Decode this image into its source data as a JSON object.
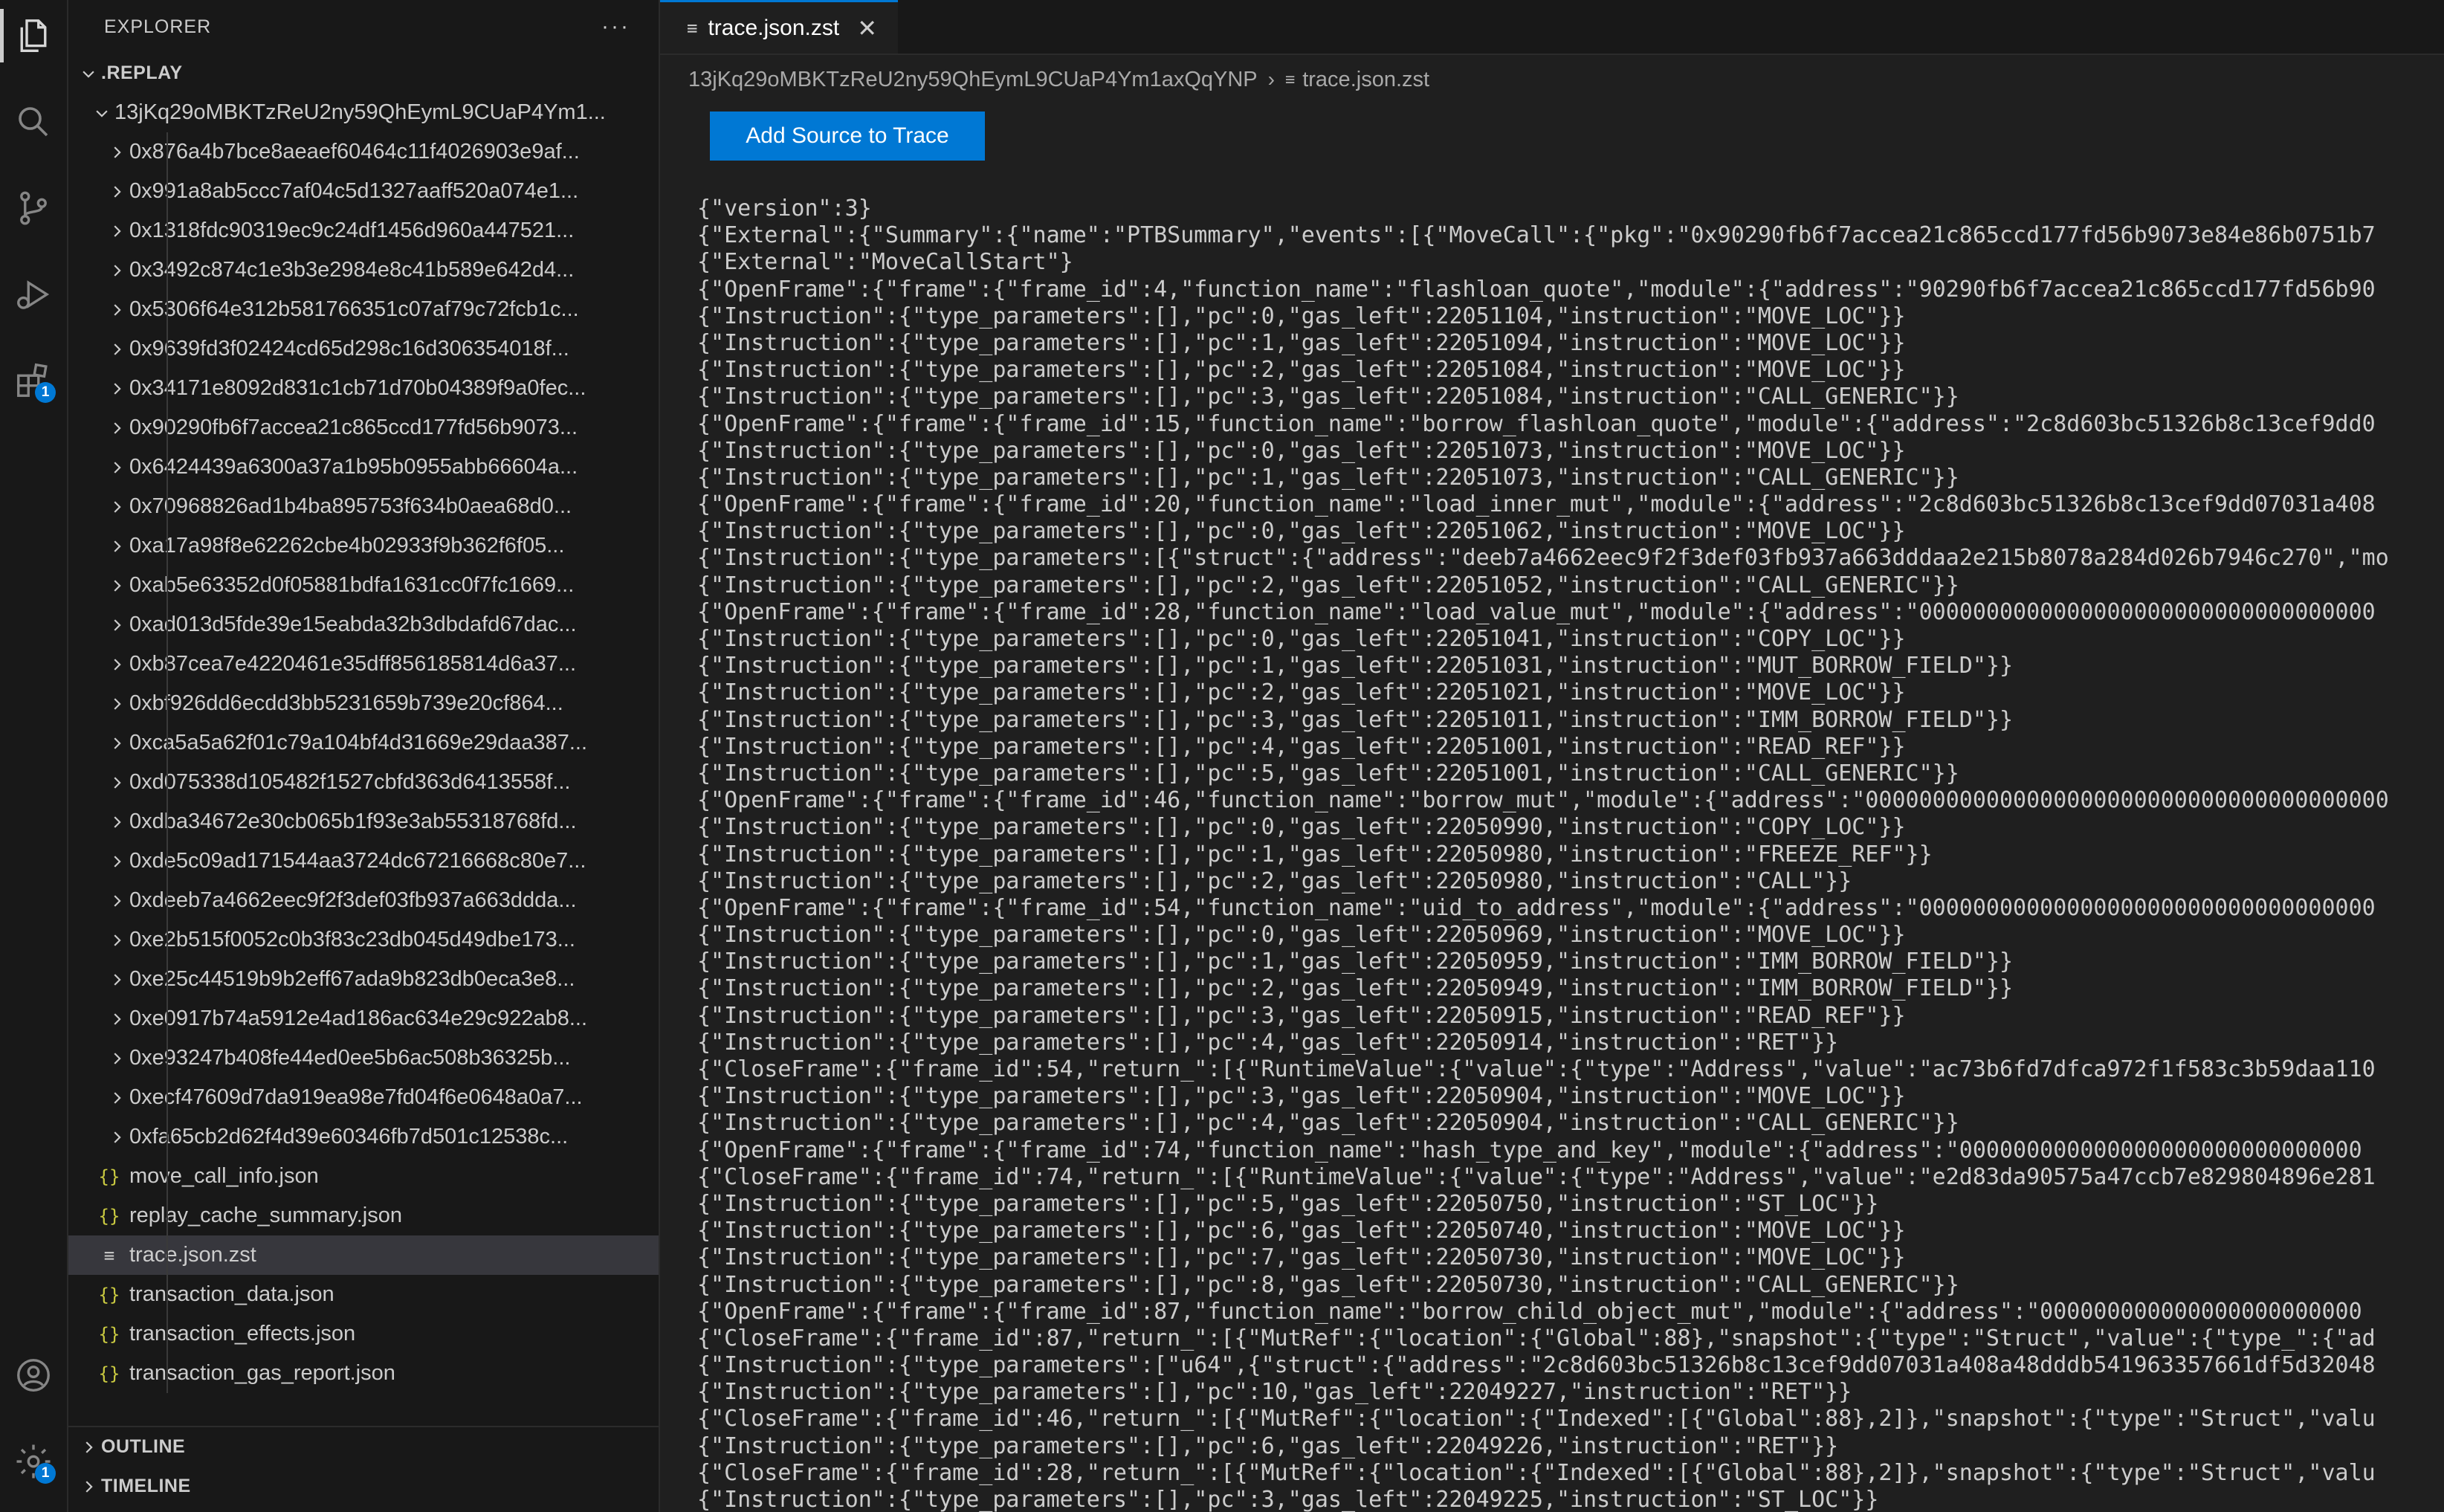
{
  "activity_bar": {
    "items": [
      {
        "name": "explorer-icon",
        "active": true
      },
      {
        "name": "search-icon"
      },
      {
        "name": "source-control-icon"
      },
      {
        "name": "run-debug-icon"
      },
      {
        "name": "extensions-icon",
        "badge": "1"
      }
    ],
    "bottom": [
      {
        "name": "account-icon"
      },
      {
        "name": "settings-gear-icon",
        "badge": "1"
      }
    ]
  },
  "sidebar": {
    "title": "EXPLORER",
    "more": "···",
    "root": ".REPLAY",
    "folder": "13jKq29oMBKTzReU2ny59QhEymL9CUaP4Ym1...",
    "subfolders": [
      "0x876a4b7bce8aeaef60464c11f4026903e9af...",
      "0x991a8ab5ccc7af04c5d1327aaff520a074e1...",
      "0x1318fdc90319ec9c24df1456d960a447521...",
      "0x3492c874c1e3b3e2984e8c41b589e642d4...",
      "0x5306f64e312b581766351c07af79c72fcb1c...",
      "0x9639fd3f02424cd65d298c16d306354018f...",
      "0x34171e8092d831c1cb71d70b04389f9a0fec...",
      "0x90290fb6f7accea21c865ccd177fd56b9073...",
      "0x6424439a6300a37a1b95b0955abb66604a...",
      "0x70968826ad1b4ba895753f634b0aea68d0...",
      "0xa17a98f8e62262cbe4b02933f9b362f6f05...",
      "0xab5e63352d0f05881bdfa1631cc0f7fc1669...",
      "0xad013d5fde39e15eabda32b3dbdafd67dac...",
      "0xb87cea7e4220461e35dff856185814d6a37...",
      "0xbf926dd6ecdd3bb5231659b739e20cf864...",
      "0xca5a5a62f01c79a104bf4d31669e29daa387...",
      "0xd075338d105482f1527cbfd363d6413558f...",
      "0xdba34672e30cb065b1f93e3ab55318768fd...",
      "0xde5c09ad171544aa3724dc67216668c80e7...",
      "0xdeeb7a4662eec9f2f3def03fb937a663ddda...",
      "0xe2b515f0052c0b3f83c23db045d49dbe173...",
      "0xe25c44519b9b2eff67ada9b823db0eca3e8...",
      "0xe0917b74a5912e4ad186ac634e29c922ab8...",
      "0xe93247b408fe44ed0ee5b6ac508b36325b...",
      "0xecf47609d7da919ea98e7fd04f6e0648a0a7...",
      "0xfa65cb2d62f4d39e60346fb7d501c12538c..."
    ],
    "files": [
      {
        "name": "move_call_info.json",
        "icon": "{}"
      },
      {
        "name": "replay_cache_summary.json",
        "icon": "{}"
      },
      {
        "name": "trace.json.zst",
        "icon": "≡",
        "selected": true
      },
      {
        "name": "transaction_data.json",
        "icon": "{}"
      },
      {
        "name": "transaction_effects.json",
        "icon": "{}"
      },
      {
        "name": "transaction_gas_report.json",
        "icon": "{}"
      }
    ],
    "outline": "OUTLINE",
    "timeline": "TIMELINE"
  },
  "editor": {
    "tab": {
      "label": "trace.json.zst",
      "icon": "≡",
      "close": "✕"
    },
    "breadcrumb": {
      "folder": "13jKq29oMBKTzReU2ny59QhEymL9CUaP4Ym1axQqYNP",
      "sep": "›",
      "file_icon": "≡",
      "file": "trace.json.zst"
    },
    "button": "Add Source to Trace",
    "lines": [
      "{\"version\":3}",
      "{\"External\":{\"Summary\":{\"name\":\"PTBSummary\",\"events\":[{\"MoveCall\":{\"pkg\":\"0x90290fb6f7accea21c865ccd177fd56b9073e84e86b0751b7",
      "{\"External\":\"MoveCallStart\"}",
      "{\"OpenFrame\":{\"frame\":{\"frame_id\":4,\"function_name\":\"flashloan_quote\",\"module\":{\"address\":\"90290fb6f7accea21c865ccd177fd56b90",
      "{\"Instruction\":{\"type_parameters\":[],\"pc\":0,\"gas_left\":22051104,\"instruction\":\"MOVE_LOC\"}}",
      "{\"Instruction\":{\"type_parameters\":[],\"pc\":1,\"gas_left\":22051094,\"instruction\":\"MOVE_LOC\"}}",
      "{\"Instruction\":{\"type_parameters\":[],\"pc\":2,\"gas_left\":22051084,\"instruction\":\"MOVE_LOC\"}}",
      "{\"Instruction\":{\"type_parameters\":[],\"pc\":3,\"gas_left\":22051084,\"instruction\":\"CALL_GENERIC\"}}",
      "{\"OpenFrame\":{\"frame\":{\"frame_id\":15,\"function_name\":\"borrow_flashloan_quote\",\"module\":{\"address\":\"2c8d603bc51326b8c13cef9dd0",
      "{\"Instruction\":{\"type_parameters\":[],\"pc\":0,\"gas_left\":22051073,\"instruction\":\"MOVE_LOC\"}}",
      "{\"Instruction\":{\"type_parameters\":[],\"pc\":1,\"gas_left\":22051073,\"instruction\":\"CALL_GENERIC\"}}",
      "{\"OpenFrame\":{\"frame\":{\"frame_id\":20,\"function_name\":\"load_inner_mut\",\"module\":{\"address\":\"2c8d603bc51326b8c13cef9dd07031a408",
      "{\"Instruction\":{\"type_parameters\":[],\"pc\":0,\"gas_left\":22051062,\"instruction\":\"MOVE_LOC\"}}",
      "{\"Instruction\":{\"type_parameters\":[{\"struct\":{\"address\":\"deeb7a4662eec9f2f3def03fb937a663dddaa2e215b8078a284d026b7946c270\",\"mo",
      "{\"Instruction\":{\"type_parameters\":[],\"pc\":2,\"gas_left\":22051052,\"instruction\":\"CALL_GENERIC\"}}",
      "{\"OpenFrame\":{\"frame\":{\"frame_id\":28,\"function_name\":\"load_value_mut\",\"module\":{\"address\":\"0000000000000000000000000000000000",
      "{\"Instruction\":{\"type_parameters\":[],\"pc\":0,\"gas_left\":22051041,\"instruction\":\"COPY_LOC\"}}",
      "{\"Instruction\":{\"type_parameters\":[],\"pc\":1,\"gas_left\":22051031,\"instruction\":\"MUT_BORROW_FIELD\"}}",
      "{\"Instruction\":{\"type_parameters\":[],\"pc\":2,\"gas_left\":22051021,\"instruction\":\"MOVE_LOC\"}}",
      "{\"Instruction\":{\"type_parameters\":[],\"pc\":3,\"gas_left\":22051011,\"instruction\":\"IMM_BORROW_FIELD\"}}",
      "{\"Instruction\":{\"type_parameters\":[],\"pc\":4,\"gas_left\":22051001,\"instruction\":\"READ_REF\"}}",
      "{\"Instruction\":{\"type_parameters\":[],\"pc\":5,\"gas_left\":22051001,\"instruction\":\"CALL_GENERIC\"}}",
      "{\"OpenFrame\":{\"frame\":{\"frame_id\":46,\"function_name\":\"borrow_mut\",\"module\":{\"address\":\"000000000000000000000000000000000000000",
      "{\"Instruction\":{\"type_parameters\":[],\"pc\":0,\"gas_left\":22050990,\"instruction\":\"COPY_LOC\"}}",
      "{\"Instruction\":{\"type_parameters\":[],\"pc\":1,\"gas_left\":22050980,\"instruction\":\"FREEZE_REF\"}}",
      "{\"Instruction\":{\"type_parameters\":[],\"pc\":2,\"gas_left\":22050980,\"instruction\":\"CALL\"}}",
      "{\"OpenFrame\":{\"frame\":{\"frame_id\":54,\"function_name\":\"uid_to_address\",\"module\":{\"address\":\"0000000000000000000000000000000000",
      "{\"Instruction\":{\"type_parameters\":[],\"pc\":0,\"gas_left\":22050969,\"instruction\":\"MOVE_LOC\"}}",
      "{\"Instruction\":{\"type_parameters\":[],\"pc\":1,\"gas_left\":22050959,\"instruction\":\"IMM_BORROW_FIELD\"}}",
      "{\"Instruction\":{\"type_parameters\":[],\"pc\":2,\"gas_left\":22050949,\"instruction\":\"IMM_BORROW_FIELD\"}}",
      "{\"Instruction\":{\"type_parameters\":[],\"pc\":3,\"gas_left\":22050915,\"instruction\":\"READ_REF\"}}",
      "{\"Instruction\":{\"type_parameters\":[],\"pc\":4,\"gas_left\":22050914,\"instruction\":\"RET\"}}",
      "{\"CloseFrame\":{\"frame_id\":54,\"return_\":[{\"RuntimeValue\":{\"value\":{\"type\":\"Address\",\"value\":\"ac73b6fd7dfca972f1f583c3b59daa110",
      "{\"Instruction\":{\"type_parameters\":[],\"pc\":3,\"gas_left\":22050904,\"instruction\":\"MOVE_LOC\"}}",
      "{\"Instruction\":{\"type_parameters\":[],\"pc\":4,\"gas_left\":22050904,\"instruction\":\"CALL_GENERIC\"}}",
      "{\"OpenFrame\":{\"frame\":{\"frame_id\":74,\"function_name\":\"hash_type_and_key\",\"module\":{\"address\":\"000000000000000000000000000000",
      "{\"CloseFrame\":{\"frame_id\":74,\"return_\":[{\"RuntimeValue\":{\"value\":{\"type\":\"Address\",\"value\":\"e2d83da90575a47ccb7e829804896e281",
      "{\"Instruction\":{\"type_parameters\":[],\"pc\":5,\"gas_left\":22050750,\"instruction\":\"ST_LOC\"}}",
      "{\"Instruction\":{\"type_parameters\":[],\"pc\":6,\"gas_left\":22050740,\"instruction\":\"MOVE_LOC\"}}",
      "{\"Instruction\":{\"type_parameters\":[],\"pc\":7,\"gas_left\":22050730,\"instruction\":\"MOVE_LOC\"}}",
      "{\"Instruction\":{\"type_parameters\":[],\"pc\":8,\"gas_left\":22050730,\"instruction\":\"CALL_GENERIC\"}}",
      "{\"OpenFrame\":{\"frame\":{\"frame_id\":87,\"function_name\":\"borrow_child_object_mut\",\"module\":{\"address\":\"000000000000000000000000",
      "{\"CloseFrame\":{\"frame_id\":87,\"return_\":[{\"MutRef\":{\"location\":{\"Global\":88},\"snapshot\":{\"type\":\"Struct\",\"value\":{\"type_\":{\"ad",
      "{\"Instruction\":{\"type_parameters\":[\"u64\",{\"struct\":{\"address\":\"2c8d603bc51326b8c13cef9dd07031a408a48dddb541963357661df5d32048",
      "{\"Instruction\":{\"type_parameters\":[],\"pc\":10,\"gas_left\":22049227,\"instruction\":\"RET\"}}",
      "{\"CloseFrame\":{\"frame_id\":46,\"return_\":[{\"MutRef\":{\"location\":{\"Indexed\":[{\"Global\":88},2]},\"snapshot\":{\"type\":\"Struct\",\"valu",
      "{\"Instruction\":{\"type_parameters\":[],\"pc\":6,\"gas_left\":22049226,\"instruction\":\"RET\"}}",
      "{\"CloseFrame\":{\"frame_id\":28,\"return_\":[{\"MutRef\":{\"location\":{\"Indexed\":[{\"Global\":88},2]},\"snapshot\":{\"type\":\"Struct\",\"valu",
      "{\"Instruction\":{\"type_parameters\":[],\"pc\":3,\"gas_left\":22049225,\"instruction\":\"ST_LOC\"}}"
    ]
  }
}
